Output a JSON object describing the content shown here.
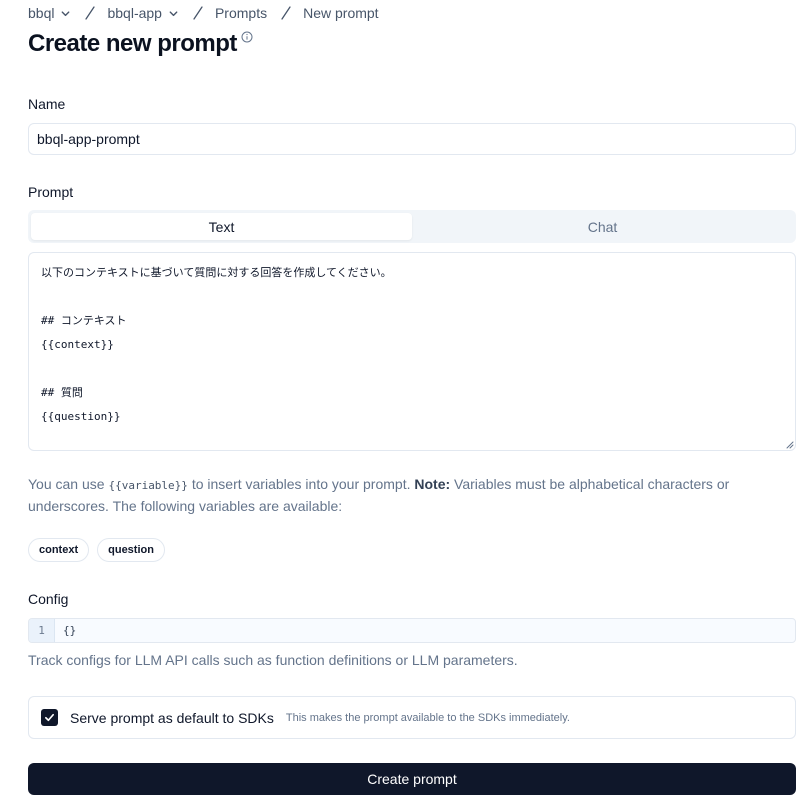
{
  "breadcrumb": {
    "items": [
      {
        "label": "bbql",
        "dropdown": true
      },
      {
        "label": "bbql-app",
        "dropdown": true
      },
      {
        "label": "Prompts",
        "dropdown": false
      },
      {
        "label": "New prompt",
        "dropdown": false
      }
    ]
  },
  "page": {
    "title": "Create new prompt"
  },
  "name_field": {
    "label": "Name",
    "value": "bbql-app-prompt"
  },
  "prompt_field": {
    "label": "Prompt",
    "tabs": [
      {
        "label": "Text",
        "active": true
      },
      {
        "label": "Chat",
        "active": false
      }
    ],
    "lines": [
      "以下のコンテキストに基づいて質問に対する回答を作成してください。",
      "",
      "## コンテキスト",
      "{{context}}",
      "",
      "## 質問",
      "{{question}}"
    ]
  },
  "help": {
    "prefix": "You can use ",
    "code": "{{variable}}",
    "middle": " to insert variables into your prompt. ",
    "note_label": "Note:",
    "suffix": " Variables must be alphabetical characters or underscores. The following variables are available:"
  },
  "variables": [
    "context",
    "question"
  ],
  "config": {
    "label": "Config",
    "line_number": "1",
    "code": "{}",
    "help": "Track configs for LLM API calls such as function definitions or LLM parameters."
  },
  "default_option": {
    "checked": true,
    "label": "Serve prompt as default to SDKs",
    "description": "This makes the prompt available to the SDKs immediately."
  },
  "submit": {
    "label": "Create prompt"
  },
  "colors": {
    "primary": "#0f172a",
    "muted_text": "#64748b",
    "border": "#e2e8f0",
    "tab_bg": "#f1f5f9"
  }
}
